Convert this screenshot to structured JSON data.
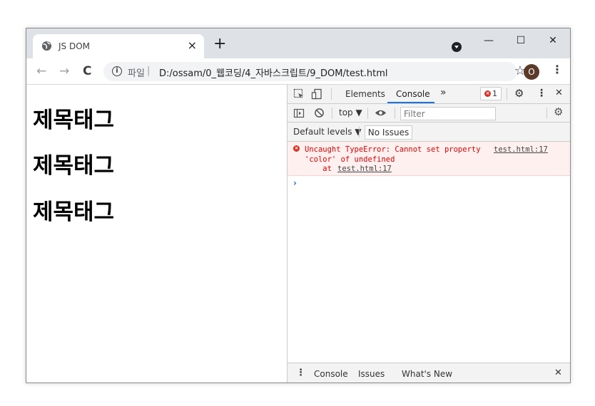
{
  "browser": {
    "tab_title": "JS DOM",
    "tab_close": "×",
    "new_tab": "+",
    "window_controls": {
      "minimize": "—",
      "maximize": "☐",
      "close": "✕"
    },
    "toolbar": {
      "back": "←",
      "forward": "→",
      "reload": "C",
      "info_icon": "i",
      "scheme_label": "파일",
      "separator": "|",
      "url": "D:/ossam/0_웹코딩/4_자바스크립트/9_DOM/test.html",
      "bookmark": "☆",
      "avatar_letter": "O",
      "menu": "⋮"
    }
  },
  "page": {
    "headings": [
      "제목태그",
      "제목태그",
      "제목태그"
    ]
  },
  "devtools": {
    "tabs": {
      "elements": "Elements",
      "console": "Console",
      "more": "»"
    },
    "error_count": "1",
    "settings": "⚙",
    "menu": "⋮",
    "close": "✕",
    "console_toolbar": {
      "context": "top ▼",
      "filter_placeholder": "Filter"
    },
    "levels": {
      "default_levels": "Default levels ▼",
      "no_issues": "No Issues"
    },
    "error": {
      "line1": "Uncaught TypeError: Cannot set property",
      "line2": "'color' of undefined",
      "line3_prefix": "    at ",
      "source_link": "test.html:17",
      "stack_link": "test.html:17"
    },
    "prompt": "›",
    "drawer": {
      "menu": "⋮",
      "console": "Console",
      "issues": "Issues",
      "whats_new": "What's New",
      "close": "✕"
    },
    "colors": {
      "error": "#d93025",
      "accent": "#1a73e8",
      "error_bg": "#fff0f0"
    }
  }
}
